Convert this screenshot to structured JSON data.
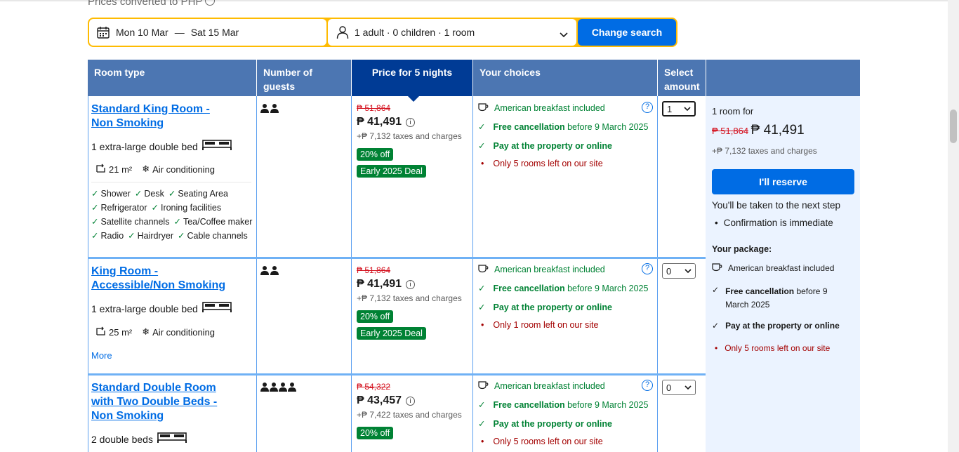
{
  "header": {
    "prices_note": "Prices converted to PHP"
  },
  "search": {
    "check_in": "Mon 10 Mar",
    "separator": "—",
    "check_out": "Sat 15 Mar",
    "guests": "1 adult · 0 children · 1 room",
    "change_label": "Change search"
  },
  "table": {
    "headers": {
      "room_type": "Room type",
      "guests": "Number of guests",
      "price": "Price for 5 nights",
      "choices": "Your choices",
      "amount": "Select amount"
    }
  },
  "rooms": [
    {
      "title_line1": "Standard King Room -",
      "title_line2": "Non Smoking",
      "bed": "1 extra-large double bed",
      "size": "21 m²",
      "ac": "Air conditioning",
      "amenities": [
        "Shower",
        "Desk",
        "Seating Area",
        "Refrigerator",
        "Ironing facilities",
        "Satellite channels",
        "Tea/Coffee maker",
        "Radio",
        "Hairdryer",
        "Cable channels"
      ],
      "old_price": "₱ 51,864",
      "price": "₱ 41,491",
      "taxes": "+₱ 7,132 taxes and charges",
      "discount": "20% off",
      "deal": "Early 2025 Deal",
      "breakfast": "American breakfast included",
      "cancel_bold": "Free cancellation",
      "cancel_rest": "before 9 March 2025",
      "pay": "Pay at the property or online",
      "scarcity": "Only 5 rooms left on our site",
      "selected": "1"
    },
    {
      "title_line1": "King Room -",
      "title_line2": "Accessible/Non Smoking",
      "bed": "1 extra-large double bed",
      "size": "25 m²",
      "ac": "Air conditioning",
      "more": "More",
      "old_price": "₱ 51,864",
      "price": "₱ 41,491",
      "taxes": "+₱ 7,132 taxes and charges",
      "discount": "20% off",
      "deal": "Early 2025 Deal",
      "breakfast": "American breakfast included",
      "cancel_bold": "Free cancellation",
      "cancel_rest": "before 9 March 2025",
      "pay": "Pay at the property or online",
      "scarcity": "Only 1 room left on our site",
      "selected": "0"
    },
    {
      "title_line1": "Standard Double Room",
      "title_line2": "with Two Double Beds -",
      "title_line3": "Non Smoking",
      "bed": "2 double beds",
      "old_price": "₱ 54,322",
      "price": "₱ 43,457",
      "taxes": "+₱ 7,422 taxes and charges",
      "discount": "20% off",
      "breakfast": "American breakfast included",
      "cancel_bold": "Free cancellation",
      "cancel_rest": "before 9 March 2025",
      "pay": "Pay at the property or online",
      "scarcity": "Only 5 rooms left on our site",
      "selected": "0"
    }
  ],
  "panel": {
    "rooms_for": "1 room for",
    "old_price": "₱ 51,864",
    "price": "₱ 41,491",
    "taxes": "+₱ 7,132 taxes and charges",
    "reserve_label": "I'll reserve",
    "next_step": "You'll be taken to the next step",
    "confirmation": "Confirmation is immediate",
    "package_title": "Your package:",
    "breakfast": "American breakfast included",
    "cancel_bold": "Free cancellation",
    "cancel_rest_1": "before 9",
    "cancel_rest_2": "March 2025",
    "pay": "Pay at the property or online",
    "scarcity": "Only 5 rooms left on our site"
  },
  "colors": {
    "accent": "#006ce4",
    "header": "#4c76b2",
    "header_dark": "#003b95",
    "search_border": "#febb02",
    "green": "#008234",
    "red": "#d4111e"
  }
}
